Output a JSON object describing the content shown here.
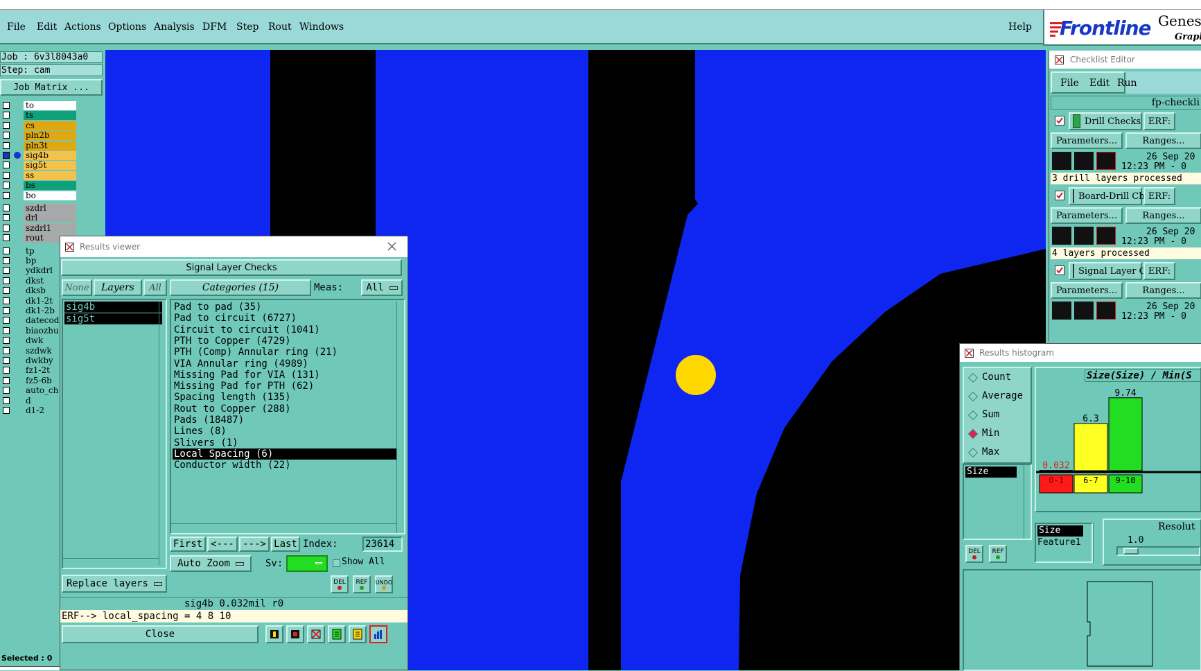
{
  "menu": {
    "items": [
      "File",
      "Edit",
      "Actions",
      "Options",
      "Analysis",
      "DFM",
      "Step",
      "Rout",
      "Windows"
    ],
    "help": "Help"
  },
  "brand": {
    "logo": "Frontline",
    "right_top": "Genes",
    "right_bottom": "Graph"
  },
  "job": {
    "job_label": "Job : 6v3l8043a0",
    "step_label": "Step: cam",
    "matrix_button": "Job Matrix ..."
  },
  "layers": [
    {
      "name": "to",
      "color": "#ffffff"
    },
    {
      "name": "ts",
      "color": "#10a07c"
    },
    {
      "name": "cs",
      "color": "#e0a810"
    },
    {
      "name": "pln2b",
      "color": "#e0a810"
    },
    {
      "name": "pln3t",
      "color": "#e0a810"
    },
    {
      "name": "sig4b",
      "color": "#f4c24a"
    },
    {
      "name": "sig5t",
      "color": "#f4c24a"
    },
    {
      "name": "ss",
      "color": "#f4c24a"
    },
    {
      "name": "bs",
      "color": "#10a07c"
    },
    {
      "name": "bo",
      "color": "#ffffff"
    },
    {
      "name": "szdrl",
      "color": "#a8a8a8"
    },
    {
      "name": "drl",
      "color": "#a8a8a8"
    },
    {
      "name": "szdrl1",
      "color": "#a8a8a8"
    },
    {
      "name": "rout",
      "color": "#a8a8a8"
    },
    {
      "name": "tp",
      "color": "#70c9b8"
    },
    {
      "name": "bp",
      "color": "#70c9b8"
    },
    {
      "name": "ydkdrl",
      "color": "#70c9b8"
    },
    {
      "name": "dkst",
      "color": "#70c9b8"
    },
    {
      "name": "dksb",
      "color": "#70c9b8"
    },
    {
      "name": "dk1-2t",
      "color": "#70c9b8"
    },
    {
      "name": "dk1-2b",
      "color": "#70c9b8"
    },
    {
      "name": "datecod",
      "color": "#70c9b8"
    },
    {
      "name": "biaozhu",
      "color": "#70c9b8"
    },
    {
      "name": "dwk",
      "color": "#70c9b8"
    },
    {
      "name": "szdwk",
      "color": "#70c9b8"
    },
    {
      "name": "dwkby",
      "color": "#70c9b8"
    },
    {
      "name": "fz1-2t",
      "color": "#70c9b8"
    },
    {
      "name": "fz5-6b",
      "color": "#70c9b8"
    },
    {
      "name": "auto_ch",
      "color": "#70c9b8"
    },
    {
      "name": "d",
      "color": "#70c9b8"
    },
    {
      "name": "d1-2",
      "color": "#70c9b8"
    }
  ],
  "selected_label": "Selected : 0",
  "results_viewer": {
    "title": "Results viewer",
    "heading": "Signal Layer Checks",
    "none_btn": "None",
    "layers_btn": "Layers",
    "all_btn": "All",
    "layer_list": [
      "sig4b",
      "sig5t"
    ],
    "categories_btn": "Categories (15)",
    "meas_label": "Meas:",
    "meas_value": "All",
    "categories": [
      "Pad to pad (35)",
      "Pad to circuit (6727)",
      "Circuit to circuit (1041)",
      "PTH to Copper (4729)",
      "PTH (Comp) Annular ring (21)",
      "VIA Annular ring (4989)",
      "Missing Pad for VIA (131)",
      "Missing Pad for PTH (62)",
      "Spacing length (135)",
      "Rout to Copper (288)",
      "Pads (18487)",
      "Lines (8)",
      "Slivers (1)",
      "Local Spacing (6)",
      "Conductor width (22)"
    ],
    "selected_category_index": 13,
    "nav": {
      "first": "First",
      "prev": "<---",
      "next": "--->",
      "last": "Last",
      "index_label": "Index:",
      "index_value": "23614"
    },
    "auto_zoom": "Auto Zoom",
    "sv_label": "Sv:",
    "show_all": "Show All",
    "replace_layers": "Replace layers",
    "icons": {
      "del": "DEL",
      "ref": "REF",
      "undo": "UNDO"
    },
    "status": "sig4b 0.032mil  r0",
    "erf_line": "ERF--> local_spacing = 4 8 10",
    "close": "Close"
  },
  "checklist": {
    "title": "Checklist Editor",
    "menu": [
      "File",
      "Edit",
      "Run"
    ],
    "name": "fp-checkli",
    "checks": [
      {
        "name": "Drill Checks",
        "erf": "ERF:",
        "params": "Parameters...",
        "ranges": "Ranges...",
        "date": "26 Sep 20",
        "time": "12:23 PM - 0",
        "status": "3 drill layers processed"
      },
      {
        "name": "Board-Drill Che",
        "erf": "ERF:",
        "params": "Parameters...",
        "ranges": "Ranges...",
        "date": "26 Sep 20",
        "time": "12:23 PM - 0",
        "status": "4 layers processed"
      },
      {
        "name": "Signal Layer Ch",
        "erf": "ERF:",
        "params": "Parameters...",
        "ranges": "Ranges...",
        "date": "26 Sep 20",
        "time": "12:23 PM - 0",
        "status": ""
      }
    ]
  },
  "histogram": {
    "title": "Results histogram",
    "options": [
      {
        "label": "Count",
        "selected": false
      },
      {
        "label": "Average",
        "selected": false
      },
      {
        "label": "Sum",
        "selected": false
      },
      {
        "label": "Min",
        "selected": true
      },
      {
        "label": "Max",
        "selected": false
      }
    ],
    "list_item": "Size",
    "list2": [
      "Size",
      "Feature1"
    ],
    "resolution_label": "Resolut",
    "resolution_value": "1.0",
    "icons": {
      "del": "DEL",
      "ref": "REF"
    },
    "chart_title": "Size(Size) / Min(S"
  },
  "chart_data": {
    "type": "bar",
    "title": "Size(Size) / Min(S",
    "categories": [
      "0-1",
      "6-7",
      "9-10"
    ],
    "values": [
      0.032,
      6.3,
      9.74
    ],
    "value_labels": [
      "0.032",
      "6.3",
      "9.74"
    ],
    "colors": [
      "#ff1a1a",
      "#ffff22",
      "#22dd22"
    ],
    "ylim": [
      0,
      10
    ]
  },
  "colors": {
    "panel": "#70c9b8",
    "copper": "#0f26f0",
    "highlight": "#ffd800"
  }
}
